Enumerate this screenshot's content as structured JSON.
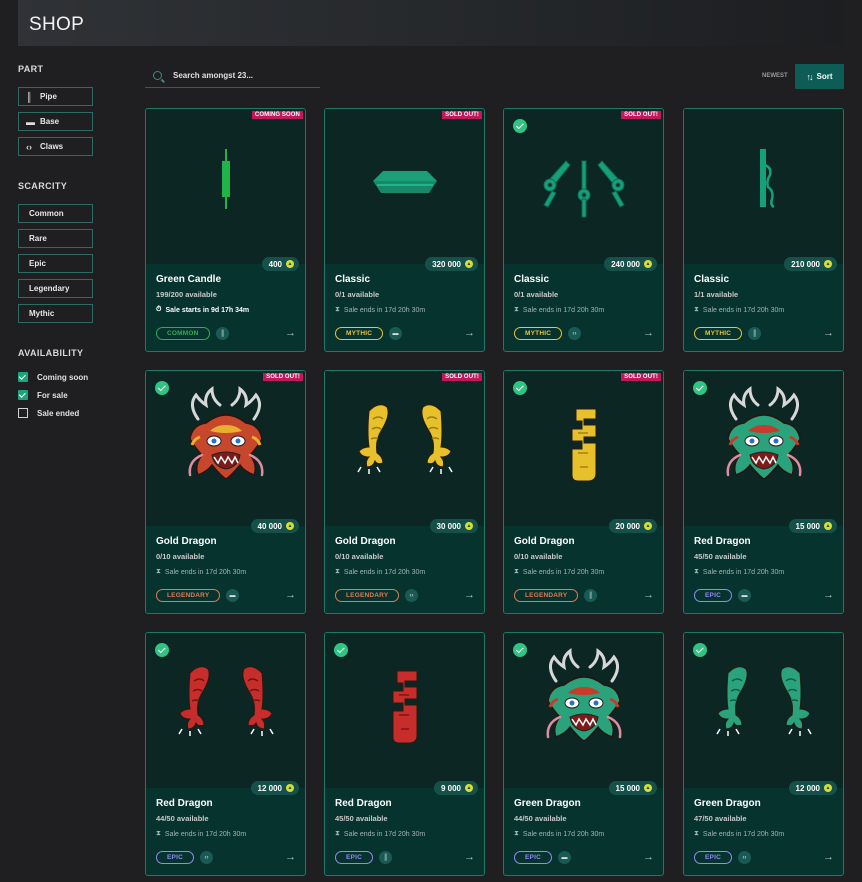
{
  "header": {
    "title": "SHOP"
  },
  "sidebar": {
    "part_heading": "PART",
    "parts": [
      {
        "label": "Pipe",
        "icon": "pipe-icon"
      },
      {
        "label": "Base",
        "icon": "base-icon"
      },
      {
        "label": "Claws",
        "icon": "claws-icon"
      }
    ],
    "scarcity_heading": "SCARCITY",
    "scarcities": [
      "Common",
      "Rare",
      "Epic",
      "Legendary",
      "Mythic"
    ],
    "availability_heading": "AVAILABILITY",
    "availability": [
      {
        "label": "Coming soon",
        "checked": true
      },
      {
        "label": "For sale",
        "checked": true
      },
      {
        "label": "Sale ended",
        "checked": false
      }
    ]
  },
  "toolbar": {
    "search_placeholder": "Search amongst 23...",
    "sort_order": "NEWEST",
    "sort_label": "Sort"
  },
  "colors": {
    "accent": "#0d5c55",
    "card_bg": "#07332f",
    "check": "#2ec482",
    "badge": "#c2185b"
  },
  "products": [
    {
      "name": "Green Candle",
      "available": "199/200 available",
      "sale": "Sale starts in 9d 17h 34m",
      "price": "400",
      "rarity": "COMMON",
      "part": "pipe",
      "badge": "COMING SOON",
      "checked": false
    },
    {
      "name": "Classic",
      "available": "0/1 available",
      "sale": "Sale ends in 17d 20h 30m",
      "price": "320 000",
      "rarity": "MYTHIC",
      "part": "base",
      "badge": "SOLD OUT!",
      "checked": false
    },
    {
      "name": "Classic",
      "available": "0/1 available",
      "sale": "Sale ends in 17d 20h 30m",
      "price": "240 000",
      "rarity": "MYTHIC",
      "part": "claws",
      "badge": "SOLD OUT!",
      "checked": true
    },
    {
      "name": "Classic",
      "available": "1/1 available",
      "sale": "Sale ends in 17d 20h 30m",
      "price": "210 000",
      "rarity": "MYTHIC",
      "part": "pipe",
      "badge": "",
      "checked": false
    },
    {
      "name": "Gold Dragon",
      "available": "0/10 available",
      "sale": "Sale ends in 17d 20h 30m",
      "price": "40 000",
      "rarity": "LEGENDARY",
      "part": "base",
      "badge": "SOLD OUT!",
      "checked": true
    },
    {
      "name": "Gold Dragon",
      "available": "0/10 available",
      "sale": "Sale ends in 17d 20h 30m",
      "price": "30 000",
      "rarity": "LEGENDARY",
      "part": "claws",
      "badge": "SOLD OUT!",
      "checked": false
    },
    {
      "name": "Gold Dragon",
      "available": "0/10 available",
      "sale": "Sale ends in 17d 20h 30m",
      "price": "20 000",
      "rarity": "LEGENDARY",
      "part": "pipe",
      "badge": "SOLD OUT!",
      "checked": true
    },
    {
      "name": "Red Dragon",
      "available": "45/50 available",
      "sale": "Sale ends in 17d 20h 30m",
      "price": "15 000",
      "rarity": "EPIC",
      "part": "base",
      "badge": "",
      "checked": true
    },
    {
      "name": "Red Dragon",
      "available": "44/50 available",
      "sale": "Sale ends in 17d 20h 30m",
      "price": "12 000",
      "rarity": "EPIC",
      "part": "claws",
      "badge": "",
      "checked": true
    },
    {
      "name": "Red Dragon",
      "available": "45/50 available",
      "sale": "Sale ends in 17d 20h 30m",
      "price": "9 000",
      "rarity": "EPIC",
      "part": "pipe",
      "badge": "",
      "checked": true
    },
    {
      "name": "Green Dragon",
      "available": "44/50 available",
      "sale": "Sale ends in 17d 20h 30m",
      "price": "15 000",
      "rarity": "EPIC",
      "part": "base",
      "badge": "",
      "checked": true
    },
    {
      "name": "Green Dragon",
      "available": "47/50 available",
      "sale": "Sale ends in 17d 20h 30m",
      "price": "12 000",
      "rarity": "EPIC",
      "part": "claws",
      "badge": "",
      "checked": true
    }
  ]
}
